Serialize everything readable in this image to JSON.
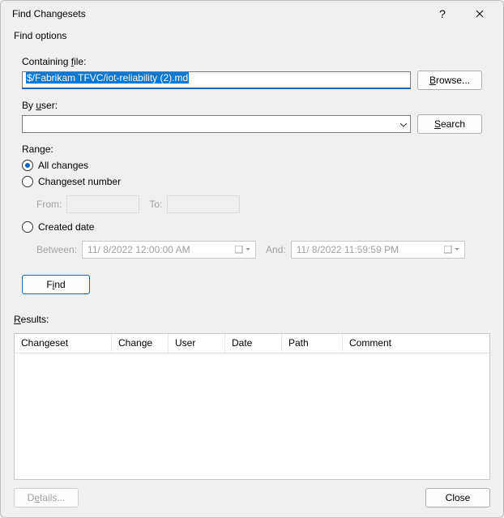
{
  "window": {
    "title": "Find Changesets",
    "help_icon": "?",
    "close_icon": "✕"
  },
  "findOptions": {
    "groupLabel": "Find options",
    "containingFile": {
      "label_pre": "Containing ",
      "label_u": "f",
      "label_post": "ile:",
      "value": "$/Fabrikam TFVC/iot-reliability (2).md",
      "browse_pre": "",
      "browse_u": "B",
      "browse_post": "rowse..."
    },
    "byUser": {
      "label_pre": "By ",
      "label_u": "u",
      "label_post": "ser:",
      "value": "",
      "search_pre": "",
      "search_u": "S",
      "search_post": "earch"
    },
    "range": {
      "label_pre": "Ran",
      "label_u": "g",
      "label_post": "e:",
      "allChanges_pre": "",
      "allChanges_u": "A",
      "allChanges_post": "ll changes",
      "changesetNumber_pre": "Changeset ",
      "changesetNumber_u": "n",
      "changesetNumber_post": "umber",
      "from_pre": "Fro",
      "from_u": "m",
      "from_post": ":",
      "to_pre": "T",
      "to_u": "o",
      "to_post": ":",
      "createdDate_pre": "",
      "createdDate_u": "C",
      "createdDate_post": "reated date",
      "between_pre": "Bet",
      "between_u": "w",
      "between_post": "een:",
      "and_pre": "An",
      "and_u": "d",
      "and_post": ":",
      "dateFrom": "11/  8/2022 12:00:00 AM",
      "dateTo": "11/  8/2022 11:59:59 PM"
    },
    "find_pre": "F",
    "find_u": "i",
    "find_post": "nd"
  },
  "results": {
    "label_pre": "",
    "label_u": "R",
    "label_post": "esults:",
    "columns": {
      "changeset": "Changeset",
      "change": "Change",
      "user": "User",
      "date": "Date",
      "path": "Path",
      "comment": "Comment"
    }
  },
  "footer": {
    "details_pre": "D",
    "details_u": "e",
    "details_post": "tails...",
    "close": "Close"
  }
}
